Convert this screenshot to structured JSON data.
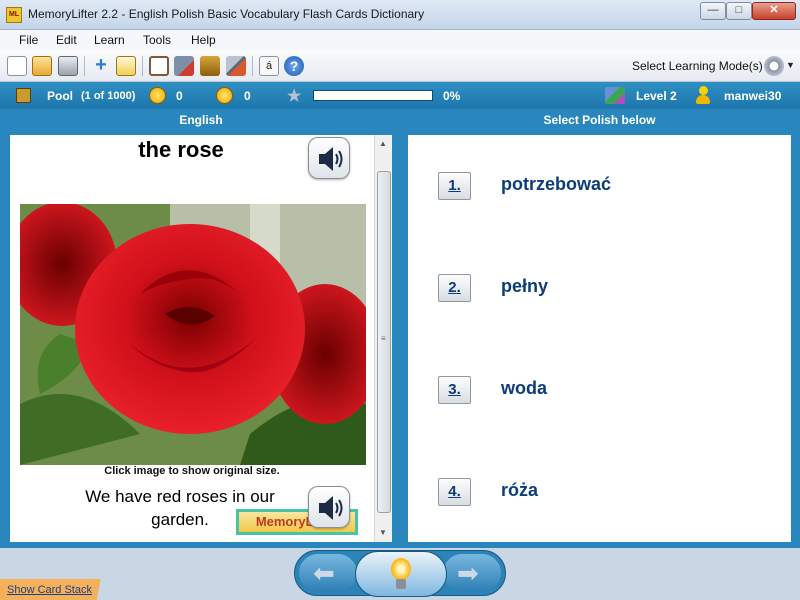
{
  "window": {
    "icon_label": "ML",
    "title": "MemoryLifter 2.2 - English Polish Basic Vocabulary Flash Cards Dictionary",
    "min": "—",
    "max": "□",
    "close": "✕"
  },
  "menu": [
    "File",
    "Edit",
    "Learn",
    "Tools",
    "Help"
  ],
  "toolbar": {
    "icons": [
      "new-icon",
      "open-icon",
      "print-icon",
      "add-icon",
      "edit-icon",
      "slideshow-icon",
      "audio-record-icon",
      "cards-icon",
      "settings-icon",
      "special-char-icon",
      "help-icon"
    ],
    "special_char": "á",
    "help": "?",
    "mode_label": "Select Learning Mode(s)"
  },
  "status": {
    "pool_label": "Pool",
    "pool_count": "(1 of 1000)",
    "correct": "0",
    "wrong": "0",
    "progress_percent": "0%",
    "progress_value": 0,
    "level": "Level 2",
    "user": "manwei30"
  },
  "question": {
    "header": "English",
    "word": "the rose",
    "caption": "Click image to show original size.",
    "sentence": "We have red roses in our garden.",
    "logo": "MemoryLifter"
  },
  "answers": {
    "header": "Select Polish below",
    "items": [
      {
        "num": "1.",
        "text": "potrzebować"
      },
      {
        "num": "2.",
        "text": "pełny"
      },
      {
        "num": "3.",
        "text": "woda"
      },
      {
        "num": "4.",
        "text": "róża"
      }
    ]
  },
  "nav": {
    "prev": "⬅",
    "next": "➡",
    "show_card_stack": "Show Card Stack"
  },
  "colors": {
    "accent": "#2a87bd",
    "answer_text": "#0d3d78",
    "status_bar": "#1d76ac"
  }
}
